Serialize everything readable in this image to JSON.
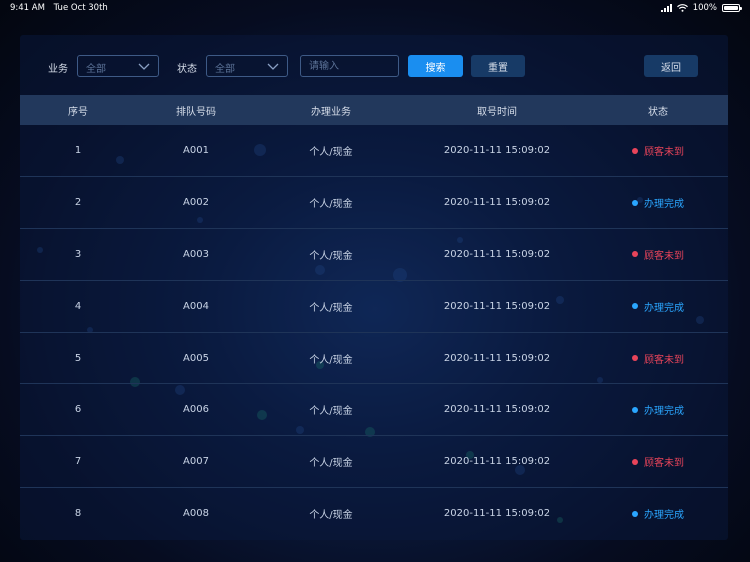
{
  "status_bar": {
    "time": "9:41 AM",
    "date": "Tue Oct 30th",
    "battery": "100%"
  },
  "filters": {
    "business_label": "业务",
    "business_value": "全部",
    "status_label": "状态",
    "status_value": "全部",
    "input_placeholder": "请输入",
    "search_label": "搜索",
    "reset_label": "重置",
    "back_label": "返回"
  },
  "table": {
    "headers": [
      "序号",
      "排队号码",
      "办理业务",
      "取号时间",
      "状态"
    ],
    "rows": [
      {
        "no": "1",
        "queue": "A001",
        "business": "个人/现金",
        "time": "2020-11-11 15:09:02",
        "status": "顾客未到",
        "status_type": "missed"
      },
      {
        "no": "2",
        "queue": "A002",
        "business": "个人/现金",
        "time": "2020-11-11 15:09:02",
        "status": "办理完成",
        "status_type": "done"
      },
      {
        "no": "3",
        "queue": "A003",
        "business": "个人/现金",
        "time": "2020-11-11 15:09:02",
        "status": "顾客未到",
        "status_type": "missed"
      },
      {
        "no": "4",
        "queue": "A004",
        "business": "个人/现金",
        "time": "2020-11-11 15:09:02",
        "status": "办理完成",
        "status_type": "done"
      },
      {
        "no": "5",
        "queue": "A005",
        "business": "个人/现金",
        "time": "2020-11-11 15:09:02",
        "status": "顾客未到",
        "status_type": "missed"
      },
      {
        "no": "6",
        "queue": "A006",
        "business": "个人/现金",
        "time": "2020-11-11 15:09:02",
        "status": "办理完成",
        "status_type": "done"
      },
      {
        "no": "7",
        "queue": "A007",
        "business": "个人/现金",
        "time": "2020-11-11 15:09:02",
        "status": "顾客未到",
        "status_type": "missed"
      },
      {
        "no": "8",
        "queue": "A008",
        "business": "个人/现金",
        "time": "2020-11-11 15:09:02",
        "status": "办理完成",
        "status_type": "done"
      }
    ]
  },
  "colors": {
    "missed": "#e8445a",
    "done": "#2aa6ff",
    "accent": "#1a8ef0"
  },
  "icons": {
    "select_arrow": "chevron-down-icon",
    "wifi": "wifi-icon",
    "signal": "signal-icon",
    "battery": "battery-icon"
  }
}
